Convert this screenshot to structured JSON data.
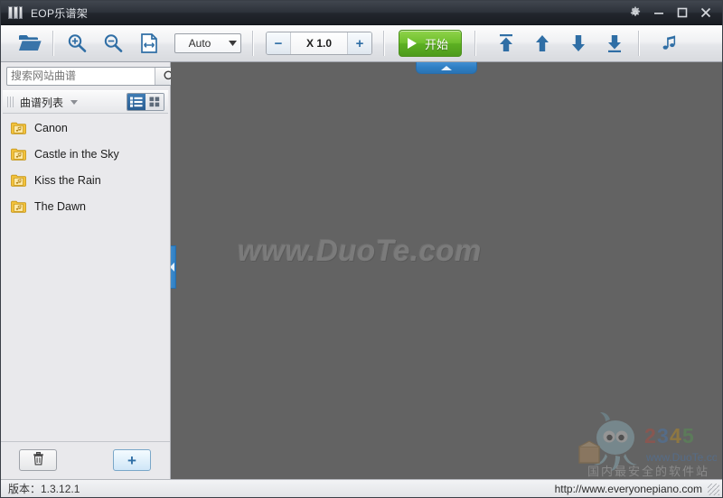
{
  "window": {
    "title": "EOP乐谱架",
    "icon": "book-icon",
    "controls": [
      {
        "name": "settings-gear",
        "glyph": "gear"
      },
      {
        "name": "minimize",
        "glyph": "minimize"
      },
      {
        "name": "maximize",
        "glyph": "maximize"
      },
      {
        "name": "close",
        "glyph": "close"
      }
    ]
  },
  "toolbar": {
    "open_icon": "open-folder-icon",
    "zoom_in_icon": "zoom-in-icon",
    "zoom_out_icon": "zoom-out-icon",
    "fit_width_icon": "fit-page-width-icon",
    "zoom_mode": "Auto",
    "speed_minus": "−",
    "speed_value": "X 1.0",
    "speed_plus": "+",
    "start_label": "开始",
    "first_page_icon": "jump-to-top-icon",
    "prev_page_icon": "page-up-icon",
    "next_page_icon": "page-down-icon",
    "last_page_icon": "jump-to-bottom-icon",
    "music_icon": "music-note-icon"
  },
  "sidebar": {
    "search": {
      "placeholder": "搜索网站曲谱",
      "value": "",
      "button_icon": "search-icon"
    },
    "list_header": {
      "title": "曲谱列表",
      "dropdown_icon": "chevron-down-icon",
      "view_list_icon": "list-view-icon",
      "view_grid_icon": "grid-view-icon",
      "active_view": "list"
    },
    "items": [
      {
        "label": "Canon",
        "icon": "music-folder-icon"
      },
      {
        "label": "Castle in the Sky",
        "icon": "music-folder-icon"
      },
      {
        "label": "Kiss the Rain",
        "icon": "music-folder-icon"
      },
      {
        "label": "The Dawn",
        "icon": "music-folder-icon"
      }
    ],
    "footer": {
      "delete_icon": "trash-icon",
      "add_label": "+"
    }
  },
  "canvas": {
    "watermark": "www.DuoTe.com",
    "top_tab_icon": "collapse-up-icon",
    "left_tab_icon": "collapse-left-icon",
    "brand_watermark": "2345软件大全",
    "brand_watermark_url": "www.DuoTe.com",
    "brand_tagline": "国内最安全的软件站",
    "background_color": "#636363"
  },
  "statusbar": {
    "version": "版本：1.3.12.1",
    "url": "http://www.everyonepiano.com"
  },
  "colors": {
    "titlebar": "#2a2e36",
    "accent_blue": "#2f6ea5",
    "start_green": "#5cb022",
    "canvas_gray": "#636363"
  }
}
